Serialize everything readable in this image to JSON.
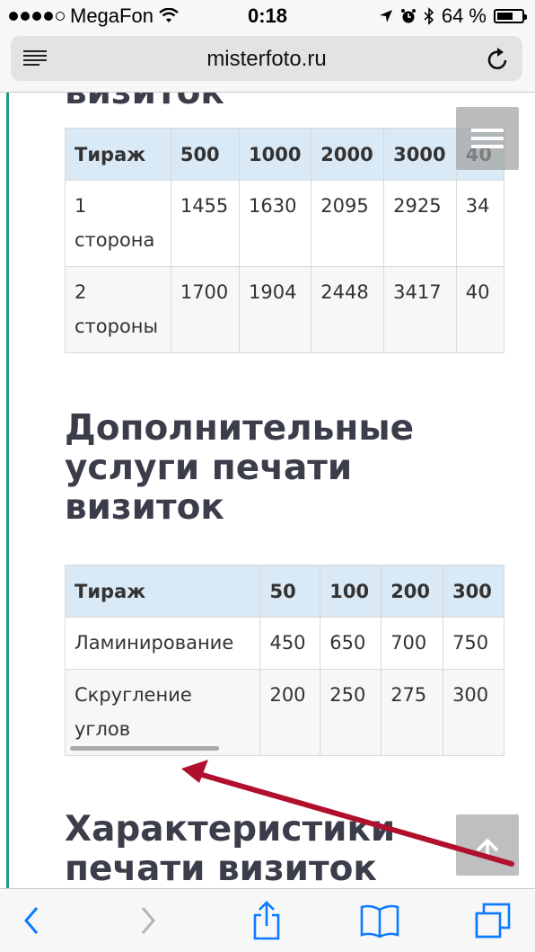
{
  "status_bar": {
    "carrier": "MegaFon",
    "time": "0:18",
    "battery": "64 %",
    "battery_level": 0.64,
    "signal_bars": 4
  },
  "browser": {
    "url": "misterfoto.ru",
    "reader_icon": "reader-mode-icon",
    "reload_icon": "reload-icon"
  },
  "content": {
    "heading_cut": "визиток",
    "table1": {
      "headers": [
        "Тираж",
        "500",
        "1000",
        "2000",
        "3000",
        "40"
      ],
      "rows": [
        {
          "label": "1 сторона",
          "values": [
            "1455",
            "1630",
            "2095",
            "2925",
            "34"
          ]
        },
        {
          "label": "2 стороны",
          "values": [
            "1700",
            "1904",
            "2448",
            "3417",
            "40"
          ]
        }
      ]
    },
    "heading2": "Дополнительные услуги печати визиток",
    "table2": {
      "headers": [
        "Тираж",
        "50",
        "100",
        "200",
        "300"
      ],
      "rows": [
        {
          "label": "Ламинирование",
          "values": [
            "450",
            "650",
            "700",
            "750"
          ]
        },
        {
          "label": "Скругление углов",
          "values": [
            "200",
            "250",
            "275",
            "300"
          ]
        }
      ]
    },
    "heading3": "Характеристики печати визиток"
  },
  "overlay": {
    "menu_icon": "hamburger-icon",
    "to_top_icon": "arrow-up-icon",
    "annotation_arrow_color": "#b0102e"
  },
  "toolbar": {
    "back_icon": "back-chevron-icon",
    "forward_icon": "forward-chevron-icon",
    "share_icon": "share-icon",
    "bookmarks_icon": "bookmarks-icon",
    "tabs_icon": "tabs-icon"
  },
  "colors": {
    "accent_line": "#1a9b7d",
    "table_header_bg": "#d9e9f5",
    "ios_blue": "#0a7aff"
  }
}
